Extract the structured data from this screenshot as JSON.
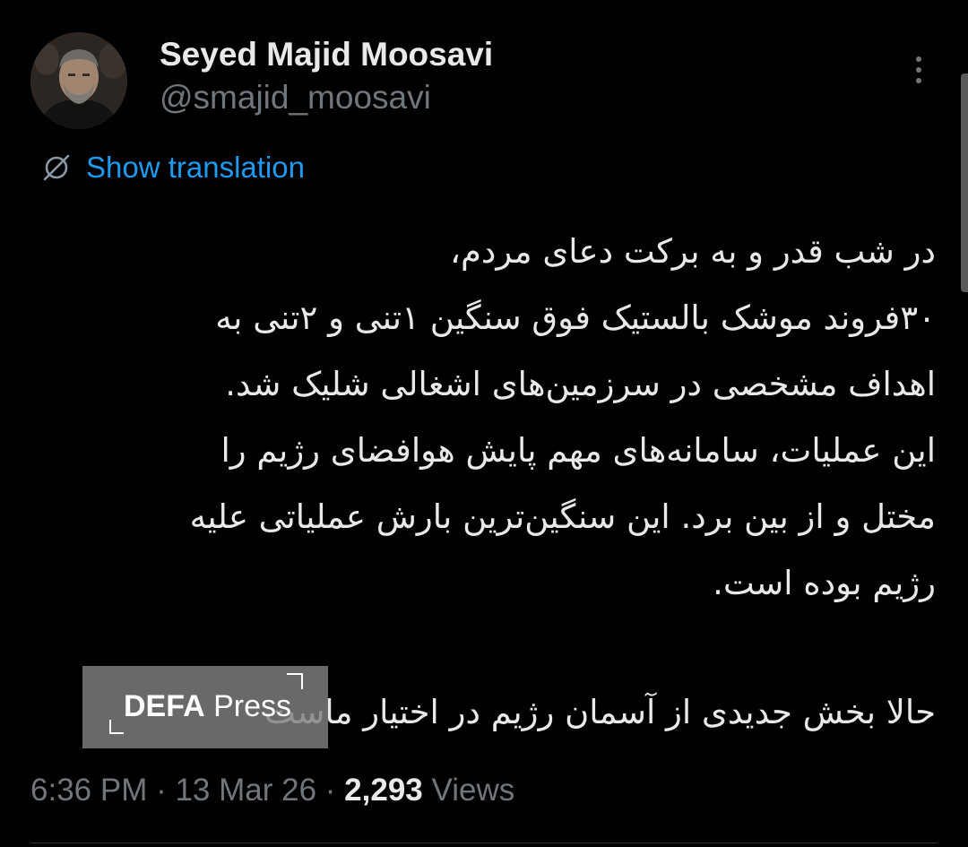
{
  "author": {
    "name": "Seyed Majid Moosavi",
    "handle": "@smajid_moosavi",
    "avatar_icon": "user-avatar-photo"
  },
  "menu": {
    "icon": "more-vertical-icon"
  },
  "translation": {
    "label": "Show translation",
    "icon": "translate-icon",
    "color": "#1d9bf0"
  },
  "tweet": {
    "lines": [
      "در شب قدر و به برکت دعای مردم،",
      "۳۰فروند موشک بالستیک فوق سنگین ۱تنی و ۲تنی به",
      "اهداف مشخصی در سرزمین‌های اشغالی شلیک شد.",
      "این عملیات، سامانه‌های مهم پایش هوافضای رژیم را",
      "مختل و از بین برد. این سنگین‌ترین بارش عملیاتی علیه",
      "رژیم بوده است.",
      "حالا بخش جدیدی از آسمان رژیم در اختیار ماست"
    ]
  },
  "watermark": {
    "brand_bold": "DEFA",
    "brand_regular": " Press"
  },
  "meta": {
    "time": "6:36 PM",
    "separator": " · ",
    "date": "13 Mar 26",
    "views_count": "2,293",
    "views_label": " Views"
  },
  "colors": {
    "background": "#000000",
    "text_primary": "#e7e9ea",
    "text_secondary": "#71767b",
    "link": "#1d9bf0"
  }
}
